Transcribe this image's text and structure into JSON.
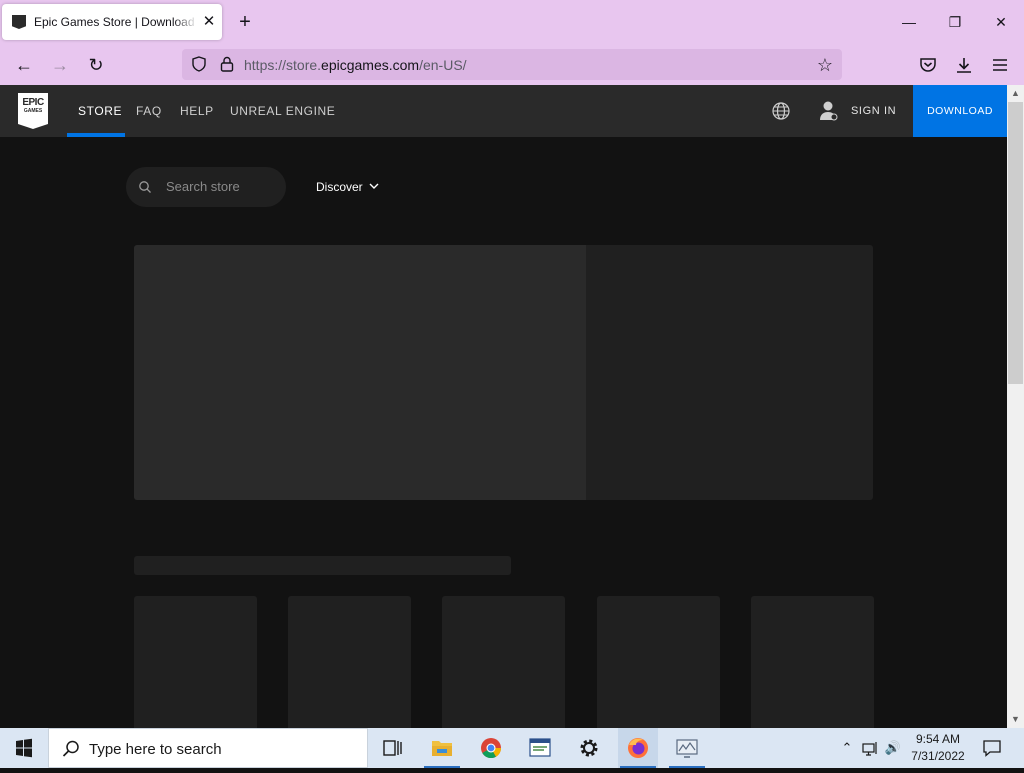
{
  "browser": {
    "tab_title": "Epic Games Store | Download & Play PC Games, Mods, DLC & More",
    "tab_close": "✕",
    "new_tab": "+",
    "window_controls": {
      "minimize": "—",
      "maximize": "❐",
      "close": "✕"
    },
    "nav": {
      "back": "←",
      "forward": "→",
      "reload": "↻"
    },
    "url": {
      "prefix": "https://store.",
      "domain": "epicgames.com",
      "path": "/en-US/"
    },
    "bookmark_star": "☆",
    "toolbar_icons": [
      "pocket-icon",
      "download-icon",
      "menu-icon"
    ]
  },
  "epic": {
    "logo": {
      "line1": "EPIC",
      "line2": "GAMES"
    },
    "nav_links": [
      "STORE",
      "FAQ",
      "HELP",
      "UNREAL ENGINE"
    ],
    "active_nav": "STORE",
    "sign_in": "SIGN IN",
    "download": "DOWNLOAD",
    "accent": "#0074e4",
    "search": {
      "placeholder": "Search store"
    },
    "discover": "Discover"
  },
  "scrollbar": {
    "up": "▲",
    "down": "▼"
  },
  "taskbar": {
    "search_placeholder": "Type here to search",
    "apps": [
      "task-view-icon",
      "file-explorer-icon",
      "chrome-icon",
      "app-icon",
      "settings-icon",
      "firefox-icon",
      "monitor-app-icon"
    ],
    "tray": {
      "chevron": "⌃",
      "volume": "🔊"
    },
    "time": "9:54 AM",
    "date": "7/31/2022"
  }
}
